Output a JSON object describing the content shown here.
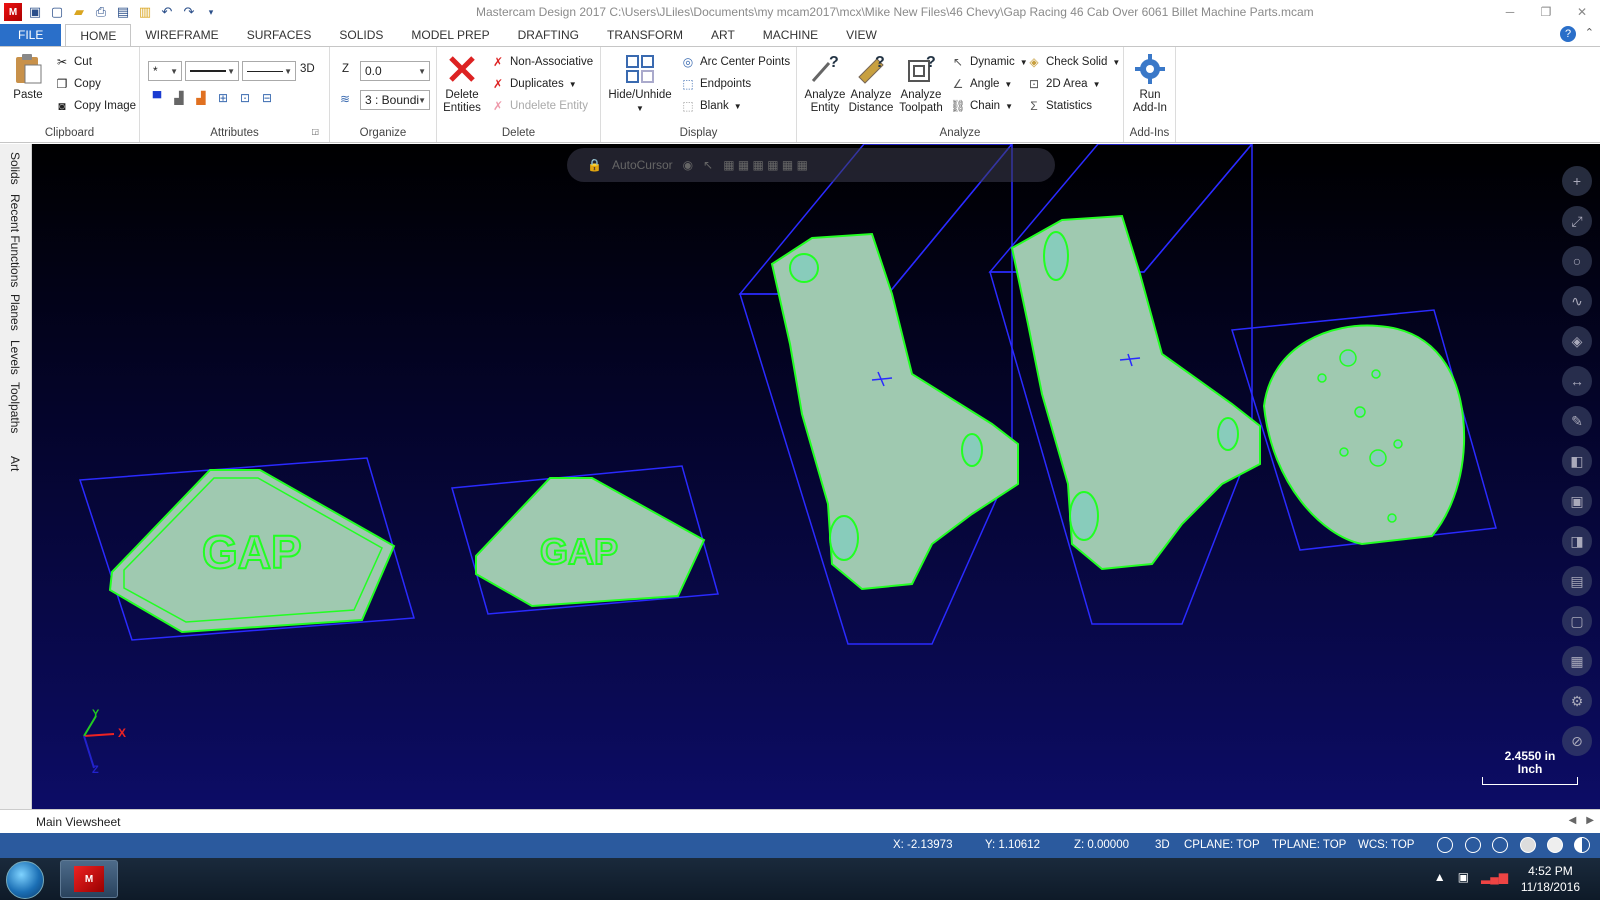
{
  "window": {
    "title": "Mastercam Design 2017  C:\\Users\\JLiles\\Documents\\my mcam2017\\mcx\\Mike New Files\\46 Chevy\\Gap Racing 46 Cab Over 6061 Billet Machine Parts.mcam"
  },
  "tabs": [
    "FILE",
    "HOME",
    "WIREFRAME",
    "SURFACES",
    "SOLIDS",
    "MODEL PREP",
    "DRAFTING",
    "TRANSFORM",
    "ART",
    "MACHINE",
    "VIEW"
  ],
  "active_tab": "HOME",
  "ribbon": {
    "clipboard": {
      "label": "Clipboard",
      "paste": "Paste",
      "cut": "Cut",
      "copy": "Copy",
      "copy_image": "Copy Image"
    },
    "attributes": {
      "label": "Attributes",
      "mode_3d": "3D"
    },
    "organize": {
      "label": "Organize",
      "z_label": "Z",
      "z_value": "0.0",
      "level_value": "3 : Boundi"
    },
    "delete": {
      "label": "Delete",
      "delete_entities": "Delete Entities",
      "non_associative": "Non-Associative",
      "duplicates": "Duplicates",
      "undelete": "Undelete Entity"
    },
    "display": {
      "label": "Display",
      "hide_unhide": "Hide/Unhide",
      "arc_center_points": "Arc Center Points",
      "endpoints": "Endpoints",
      "blank": "Blank"
    },
    "analyze": {
      "label": "Analyze",
      "analyze_entity": "Analyze Entity",
      "analyze_distance": "Analyze Distance",
      "analyze_toolpath": "Analyze Toolpath",
      "dynamic": "Dynamic",
      "angle": "Angle",
      "chain": "Chain",
      "check_solid": "Check Solid",
      "area_2d": "2D Area",
      "statistics": "Statistics"
    },
    "addins": {
      "label": "Add-Ins",
      "run_addin": "Run Add-In"
    }
  },
  "side_tabs": [
    "Solids",
    "Recent Functions",
    "Planes",
    "Levels",
    "Toolpaths",
    "Art"
  ],
  "viewport": {
    "autocursor_label": "AutoCursor",
    "scale_value": "2.4550 in",
    "scale_unit": "Inch",
    "axis_x": "X",
    "axis_y": "Y",
    "axis_z": "Z"
  },
  "viewsheet": {
    "tab": "Main Viewsheet"
  },
  "status": {
    "x": "X:  -2.13973",
    "y": "Y:  1.10612",
    "z": "Z:  0.00000",
    "mode": "3D",
    "cplane": "CPLANE: TOP",
    "tplane": "TPLANE: TOP",
    "wcs": "WCS: TOP"
  },
  "taskbar": {
    "time": "4:52 PM",
    "date": "11/18/2016"
  },
  "colors": {
    "accent": "#2a6fc9",
    "status_bar": "#2b5a9e",
    "part_fill": "#9fc9b0",
    "part_edge": "#22ff22",
    "bbox": "#2a2aff"
  }
}
